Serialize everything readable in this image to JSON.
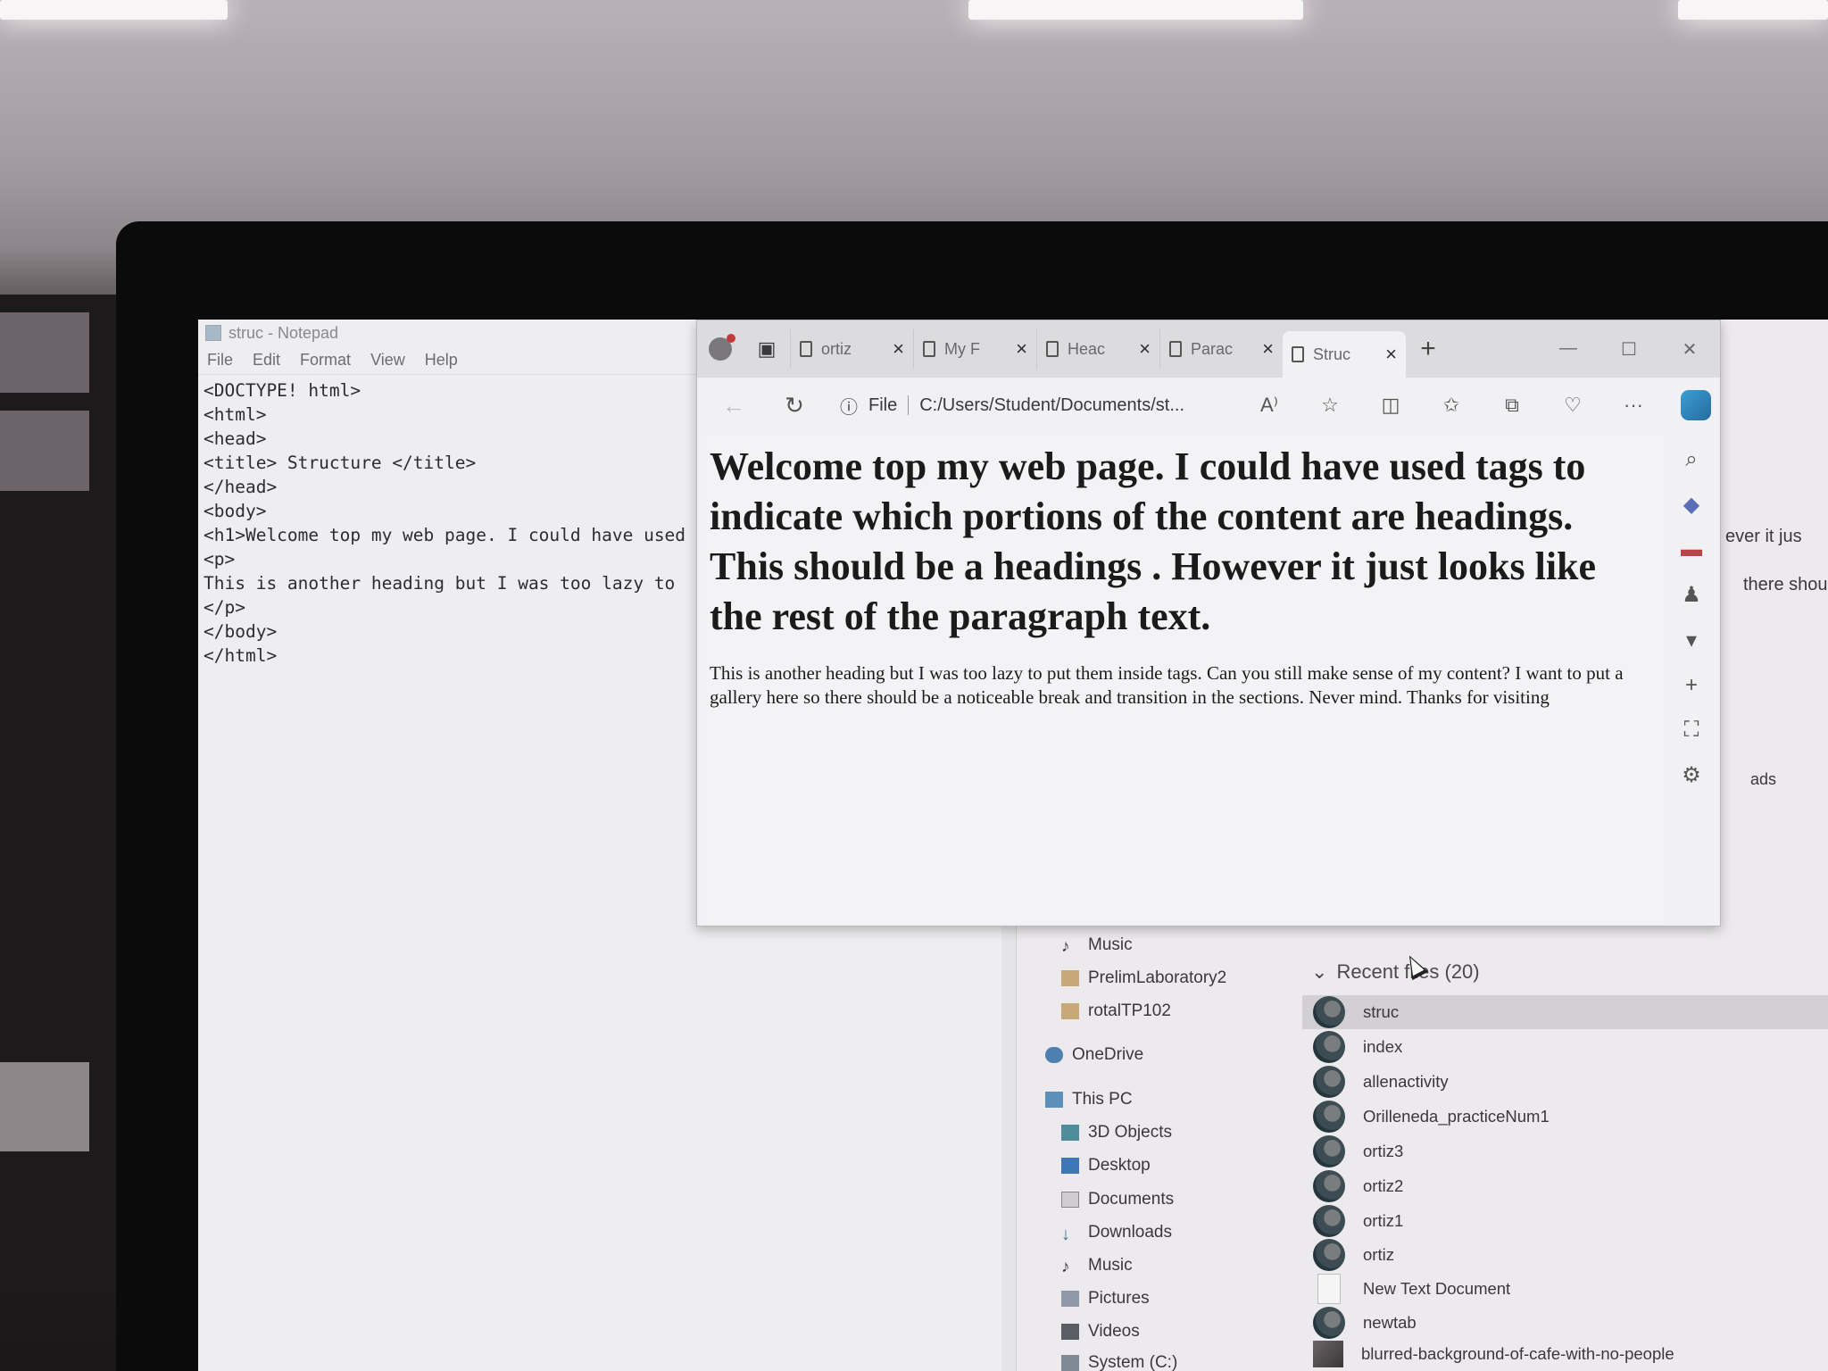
{
  "notepad": {
    "title": "struc - Notepad",
    "menu": [
      "File",
      "Edit",
      "Format",
      "View",
      "Help"
    ],
    "lines": [
      "<DOCTYPE! html>",
      "<html>",
      "<head>",
      "<title> Structure </title>",
      "</head>",
      "<body>",
      "<h1>Welcome top my web page. I could have used",
      "<p>",
      "This is another heading but I was too lazy to",
      "</p>",
      "</body>",
      "</html>"
    ]
  },
  "browser": {
    "tabs": [
      {
        "title": "ortiz"
      },
      {
        "title": "My F"
      },
      {
        "title": "Heac"
      },
      {
        "title": "Parac"
      },
      {
        "title": "Struc",
        "active": true
      }
    ],
    "new_tab": "+",
    "url_label": "File",
    "url": "C:/Users/Student/Documents/st...",
    "heading": "Welcome top my web page. I could have used tags to indicate which portions of the content are headings. This should be a headings . However it just looks like the rest of the paragraph text.",
    "paragraph": "This is another heading but I was too lazy to put them inside tags. Can you still make sense of my content? I want to put a gallery here so there should be a noticeable break and transition in the sections. Never mind. Thanks for visiting"
  },
  "explorer": {
    "nav_items": [
      "Music",
      "PrelimLaboratory2",
      "rotalTP102",
      "OneDrive",
      "This PC",
      "3D Objects",
      "Desktop",
      "Documents",
      "Downloads",
      "Music",
      "Pictures",
      "Videos",
      "System (C:)"
    ],
    "recent_header": "Recent files (20)",
    "recent_files": [
      "struc",
      "index",
      "allenactivity",
      "Orilleneda_practiceNum1",
      "ortiz3",
      "ortiz2",
      "ortiz1",
      "ortiz",
      "New Text Document",
      "newtab",
      "blurred-background-of-cafe-with-no-people"
    ],
    "right_fragments": [
      "ever it jus",
      "there shou",
      "ads"
    ]
  }
}
